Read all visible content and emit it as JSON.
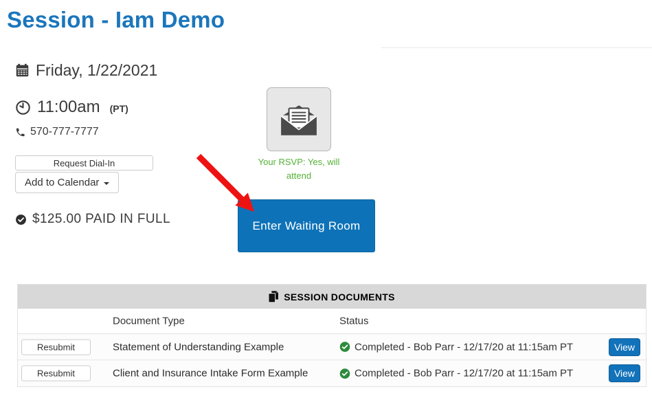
{
  "page": {
    "title": "Session - Iam Demo"
  },
  "session": {
    "date": "Friday, 1/22/2021",
    "time": "11:00am",
    "timezone": "(PT)",
    "phone": "570-777-7777",
    "request_dial_in_label": "Request Dial-In",
    "add_to_calendar_label": "Add to Calendar",
    "payment_status": "$125.00 PAID IN FULL",
    "rsvp_status": "Your RSVP: Yes, will attend",
    "enter_waiting_room_label": "Enter Waiting Room"
  },
  "documents_table": {
    "title": "SESSION DOCUMENTS",
    "columns": {
      "document_type": "Document Type",
      "status": "Status"
    },
    "resubmit_label": "Resubmit",
    "view_label": "View",
    "rows": [
      {
        "document_type": "Statement of Understanding Example",
        "status": "Completed - Bob Parr - 12/17/20 at 11:15am PT"
      },
      {
        "document_type": "Client and Insurance Intake Form Example",
        "status": "Completed - Bob Parr - 12/17/20 at 11:15am PT"
      }
    ]
  },
  "colors": {
    "title_blue": "#1b76bc",
    "primary_button_blue": "#0e72b8",
    "view_button_blue": "#1272ba",
    "rsvp_green": "#54b235",
    "status_check_green": "#2e8b3d",
    "arrow_red": "#ee1313",
    "table_header_gray": "#d8d8d8"
  }
}
